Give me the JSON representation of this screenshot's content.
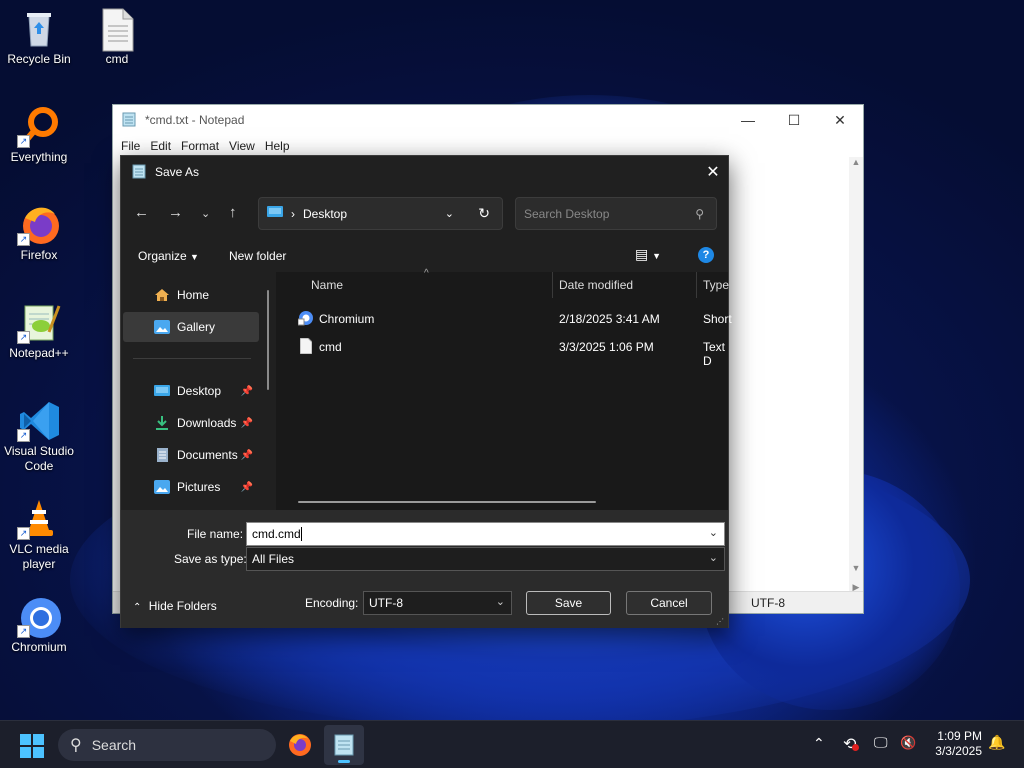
{
  "desktop": {
    "icons": [
      {
        "label": "Recycle Bin",
        "icon": "recycle-bin-icon"
      },
      {
        "label": "cmd",
        "icon": "text-file-icon"
      },
      {
        "label": "Everything",
        "icon": "everything-icon"
      },
      {
        "label": "Firefox",
        "icon": "firefox-icon"
      },
      {
        "label": "Notepad++",
        "icon": "notepad-plus-plus-icon"
      },
      {
        "label": "Visual Studio Code",
        "icon": "vscode-icon"
      },
      {
        "label": "VLC media player",
        "icon": "vlc-icon"
      },
      {
        "label": "Chromium",
        "icon": "chromium-icon"
      }
    ]
  },
  "notepad": {
    "title": "*cmd.txt - Notepad",
    "menu": [
      "File",
      "Edit",
      "Format",
      "View",
      "Help"
    ],
    "status_encoding": "UTF-8"
  },
  "dialog": {
    "title": "Save As",
    "address": "Desktop",
    "search_placeholder": "Search Desktop",
    "toolbar": {
      "organize": "Organize",
      "new_folder": "New folder"
    },
    "sidebar": {
      "home": "Home",
      "gallery": "Gallery",
      "desktop": "Desktop",
      "downloads": "Downloads",
      "documents": "Documents",
      "pictures": "Pictures"
    },
    "columns": {
      "name": "Name",
      "date": "Date modified",
      "type": "Type"
    },
    "files": [
      {
        "name": "Chromium",
        "date": "2/18/2025 3:41 AM",
        "type": "Short"
      },
      {
        "name": "cmd",
        "date": "3/3/2025 1:06 PM",
        "type": "Text D"
      }
    ],
    "file_name_label": "File name:",
    "file_name_value": "cmd.cmd",
    "save_type_label": "Save as type:",
    "save_type_value": "All Files",
    "hide_folders": "Hide Folders",
    "encoding_label": "Encoding:",
    "encoding_value": "UTF-8",
    "save_button": "Save",
    "cancel_button": "Cancel"
  },
  "taskbar": {
    "search": "Search",
    "time": "1:09 PM",
    "date": "3/3/2025"
  },
  "colors": {
    "accent": "#4ca0ff",
    "dialog_bg": "#202020",
    "taskbar_bg": "#1c1f2b"
  }
}
